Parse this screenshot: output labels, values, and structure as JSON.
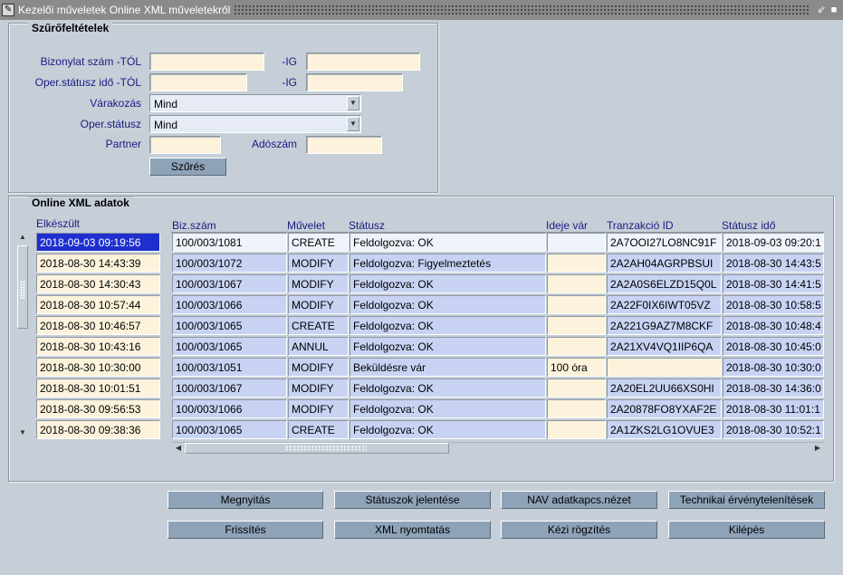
{
  "window": {
    "icon": "app-icon",
    "title": "Kezelői műveletek Online XML műveletekről",
    "buttons": [
      "minimize-icon",
      "close-icon"
    ]
  },
  "filter": {
    "title": "Szűrőfeltételek",
    "labels": {
      "biz_from": "Bizonylat szám -TÓL",
      "biz_to": "-IG",
      "status_time_from": "Oper.státusz idő -TÓL",
      "status_time_to": "-IG",
      "waiting": "Várakozás",
      "oper_status": "Oper.státusz",
      "partner": "Partner",
      "tax_no": "Adószám"
    },
    "values": {
      "biz_from": "",
      "biz_to": "",
      "status_time_from": "",
      "status_time_to": "",
      "waiting": "Mind",
      "oper_status": "Mind",
      "partner": "",
      "tax_no": ""
    },
    "filter_button": "Szűrés"
  },
  "data_section": {
    "title": "Online XML adatok",
    "completed_header": "Elkészült",
    "completed": [
      "2018-09-03 09:19:56",
      "2018-08-30 14:43:39",
      "2018-08-30 14:30:43",
      "2018-08-30 10:57:44",
      "2018-08-30 10:46:57",
      "2018-08-30 10:43:16",
      "2018-08-30 10:30:00",
      "2018-08-30 10:01:51",
      "2018-08-30 09:56:53",
      "2018-08-30 09:38:36"
    ],
    "columns": [
      "Biz.szám",
      "Művelet",
      "Státusz",
      "Ideje vár",
      "Tranzakció ID",
      "Státusz idő"
    ],
    "rows": [
      {
        "biz": "100/003/1081",
        "op": "CREATE",
        "status": "Feldolgozva:  OK",
        "wait": "",
        "tx": "2A7OOI27LO8NC91F",
        "time": "2018-09-03 09:20:1"
      },
      {
        "biz": "100/003/1072",
        "op": "MODIFY",
        "status": "Feldolgozva: Figyelmeztetés",
        "wait": "",
        "tx": "2A2AH04AGRPBSUI",
        "time": "2018-08-30 14:43:5"
      },
      {
        "biz": "100/003/1067",
        "op": "MODIFY",
        "status": "Feldolgozva:  OK",
        "wait": "",
        "tx": "2A2A0S6ELZD15Q0L",
        "time": "2018-08-30 14:41:5"
      },
      {
        "biz": "100/003/1066",
        "op": "MODIFY",
        "status": "Feldolgozva:  OK",
        "wait": "",
        "tx": "2A22F0IX6IWT05VZ",
        "time": "2018-08-30 10:58:5"
      },
      {
        "biz": "100/003/1065",
        "op": "CREATE",
        "status": "Feldolgozva:  OK",
        "wait": "",
        "tx": "2A221G9AZ7M8CKF",
        "time": "2018-08-30 10:48:4"
      },
      {
        "biz": "100/003/1065",
        "op": "ANNUL",
        "status": "Feldolgozva:  OK",
        "wait": "",
        "tx": "2A21XV4VQ1IIP6QA",
        "time": "2018-08-30 10:45:0"
      },
      {
        "biz": "100/003/1051",
        "op": "MODIFY",
        "status": "Beküldésre vár",
        "wait": "100 óra",
        "tx": "",
        "time": "2018-08-30 10:30:0"
      },
      {
        "biz": "100/003/1067",
        "op": "MODIFY",
        "status": "Feldolgozva:  OK",
        "wait": "",
        "tx": "2A20EL2UU66XS0HI",
        "time": "2018-08-30 14:36:0"
      },
      {
        "biz": "100/003/1066",
        "op": "MODIFY",
        "status": "Feldolgozva:  OK",
        "wait": "",
        "tx": "2A20878FO8YXAF2E",
        "time": "2018-08-30 11:01:1"
      },
      {
        "biz": "100/003/1065",
        "op": "CREATE",
        "status": "Feldolgozva:  OK",
        "wait": "",
        "tx": "2A1ZKS2LG1OVUE3",
        "time": "2018-08-30 10:52:1"
      }
    ]
  },
  "actions": {
    "row1": [
      "Megnyitás",
      "Státuszok jelentése",
      "NAV adatkapcs.nézet",
      "Technikai érvénytelenítések"
    ],
    "row2": [
      "Frissítés",
      "XML nyomtatás",
      "Kézi rögzítés",
      "Kilépés"
    ]
  },
  "colors": {
    "background": "#c6cfd8",
    "selected": "#1e2fd0",
    "row_blue": "#c8d3f4",
    "field_cream": "#fdf3dc",
    "label": "#1a1a80",
    "button": "#8ea2b8"
  }
}
